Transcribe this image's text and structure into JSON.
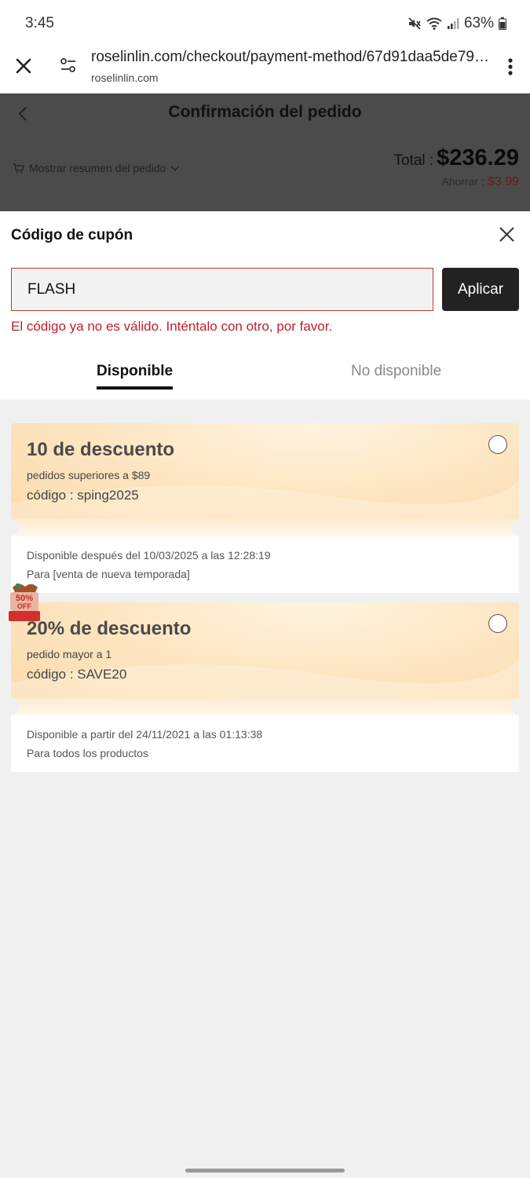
{
  "status_bar": {
    "time": "3:45",
    "battery": "63%"
  },
  "browser": {
    "url": "roselinlin.com/checkout/payment-method/67d91daa5de796163...",
    "domain": "roselinlin.com"
  },
  "page": {
    "title": "Confirmación del pedido",
    "summary_toggle": "Mostrar resumen del pedido",
    "total_label": "Total :",
    "total_value": "$236.29",
    "save_label": "Ahorrar :",
    "save_value": "$3.99"
  },
  "coupon_panel": {
    "title": "Código de cupón",
    "input_value": "FLASH",
    "apply_label": "Aplicar",
    "error": "El código ya no es válido. Inténtalo con otro, por favor.",
    "tabs": [
      {
        "label": "Disponible",
        "active": true
      },
      {
        "label": "No disponible",
        "active": false
      }
    ]
  },
  "coupons": [
    {
      "title": "10 de descuento",
      "min_order": "pedidos superiores a $89",
      "code": "código : sping2025",
      "availability": "Disponible después del 10/03/2025 a las 12:28:19",
      "scope": "Para [venta de nueva temporada]",
      "selected": false
    },
    {
      "title": "20% de descuento",
      "min_order": "pedido mayor a 1",
      "code": "código : SAVE20",
      "availability": "Disponible a partir del 24/11/2021 a las 01:13:38",
      "scope": "Para todos los productos",
      "selected": false
    }
  ],
  "promo_badge": {
    "text_top": "50%",
    "text_bottom": "OFF"
  },
  "colors": {
    "error": "#c0202a",
    "apply_button": "#222222",
    "coupon_card": "#fde6c3",
    "overlay_header": "#4b4b4b",
    "save_value": "#6b1a1a"
  }
}
